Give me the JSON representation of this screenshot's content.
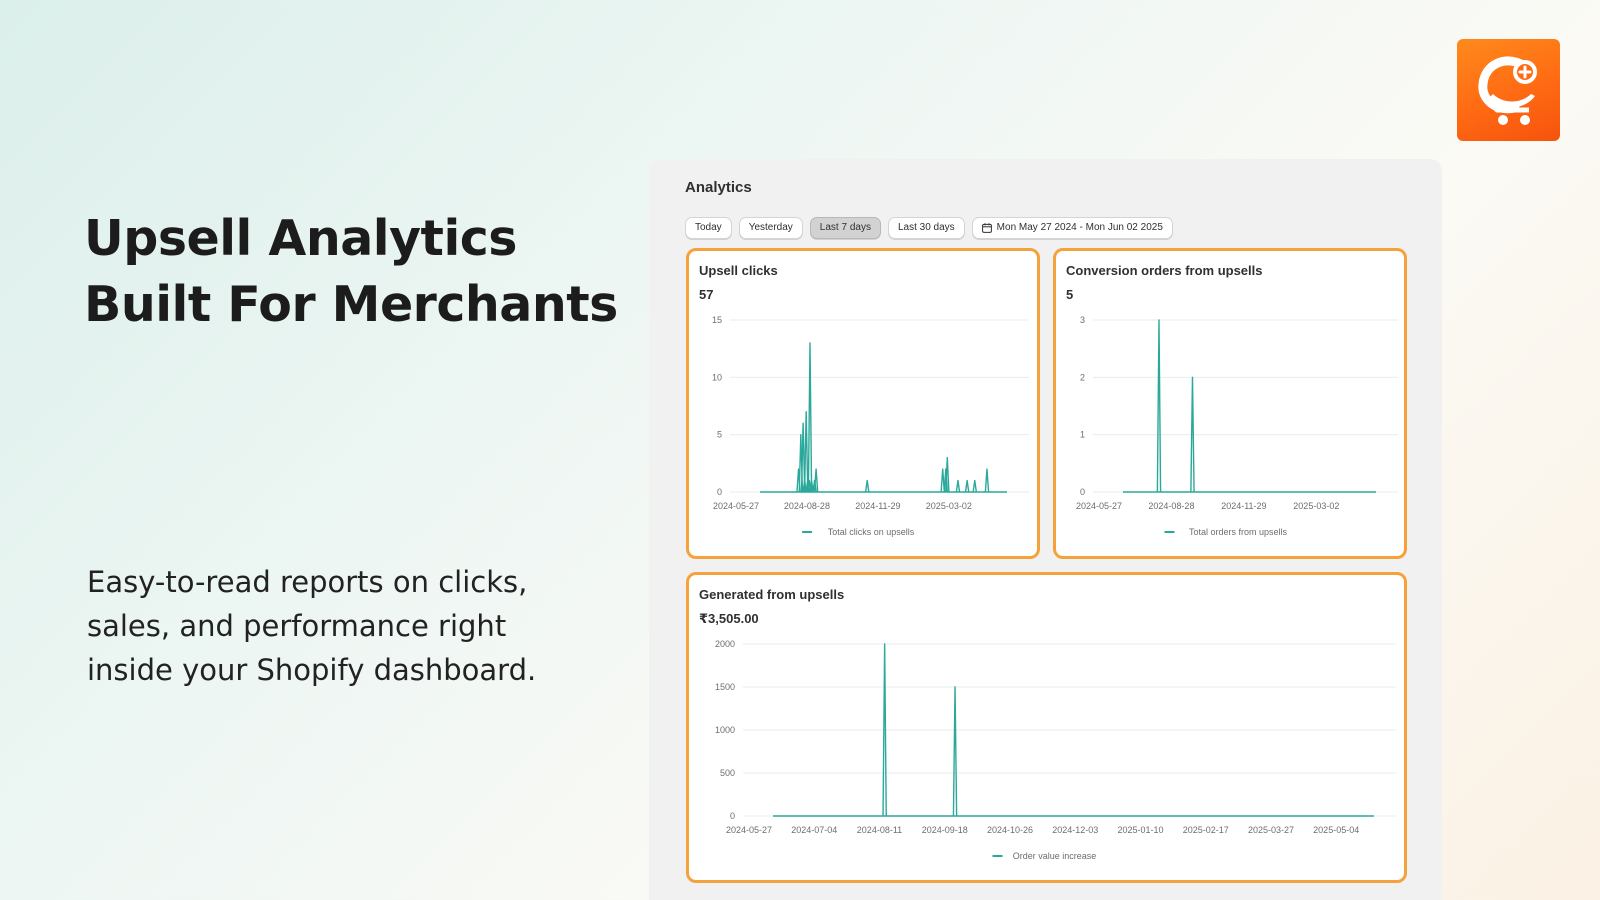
{
  "hero": {
    "title_line1": "Upsell Analytics",
    "title_line2": "Built For Merchants",
    "subtitle_line1": "Easy-to-read reports on clicks,",
    "subtitle_line2": "sales, and performance right",
    "subtitle_line3": "inside your Shopify dashboard."
  },
  "logo": {
    "icon": "cart-swirl-logo-icon",
    "color": "#ff6a13"
  },
  "analytics": {
    "title": "Analytics",
    "filters": [
      "Today",
      "Yesterday",
      "Last 7 days",
      "Last 30 days"
    ],
    "active_filter": "Last 7 days",
    "date_range": "Mon May 27 2024 - Mon Jun 02 2025",
    "date_icon": "calendar-icon"
  },
  "colors": {
    "accent_border": "#f5a23a",
    "series": "#2aa89a"
  },
  "chart_data": [
    {
      "type": "line",
      "title": "Upsell clicks",
      "total": "57",
      "legend": "Total clicks on upsells",
      "yticks": [
        "15",
        "10",
        "5",
        "0"
      ],
      "ylim": [
        0,
        15
      ],
      "xticks": [
        "2024-05-27",
        "2024-08-28",
        "2024-11-29",
        "2025-03-02"
      ],
      "x_start": "2024-05-27",
      "x_end": "2025-06-02",
      "points": [
        {
          "x": "2024-08-17",
          "y": 2
        },
        {
          "x": "2024-08-20",
          "y": 5
        },
        {
          "x": "2024-08-23",
          "y": 6
        },
        {
          "x": "2024-08-25",
          "y": 1
        },
        {
          "x": "2024-08-27",
          "y": 7
        },
        {
          "x": "2024-08-29",
          "y": 1
        },
        {
          "x": "2024-08-31",
          "y": 1
        },
        {
          "x": "2024-09-01",
          "y": 13
        },
        {
          "x": "2024-09-03",
          "y": 1
        },
        {
          "x": "2024-09-07",
          "y": 1
        },
        {
          "x": "2024-09-09",
          "y": 2
        },
        {
          "x": "2024-11-15",
          "y": 1
        },
        {
          "x": "2025-02-22",
          "y": 2
        },
        {
          "x": "2025-02-26",
          "y": 2
        },
        {
          "x": "2025-02-28",
          "y": 3
        },
        {
          "x": "2025-03-14",
          "y": 1
        },
        {
          "x": "2025-03-26",
          "y": 1
        },
        {
          "x": "2025-04-05",
          "y": 1
        },
        {
          "x": "2025-04-21",
          "y": 2
        }
      ]
    },
    {
      "type": "line",
      "title": "Conversion orders from upsells",
      "total": "5",
      "legend": "Total orders from upsells",
      "yticks": [
        "3",
        "2",
        "1",
        "0"
      ],
      "ylim": [
        0,
        3
      ],
      "xticks": [
        "2024-05-27",
        "2024-08-28",
        "2024-11-29",
        "2025-03-02"
      ],
      "x_start": "2024-05-27",
      "x_end": "2025-06-02",
      "points": [
        {
          "x": "2024-08-12",
          "y": 3
        },
        {
          "x": "2024-09-24",
          "y": 2
        }
      ]
    },
    {
      "type": "line",
      "title": "Generated from upsells",
      "total": "₹3,505.00",
      "legend": "Order value increase",
      "yticks": [
        "2000",
        "1500",
        "1000",
        "500",
        "0"
      ],
      "ylim": [
        0,
        2000
      ],
      "xticks": [
        "2024-05-27",
        "2024-07-04",
        "2024-08-11",
        "2024-09-18",
        "2024-10-26",
        "2024-12-03",
        "2025-01-10",
        "2025-02-17",
        "2025-03-27",
        "2025-05-04"
      ],
      "x_start": "2024-05-27",
      "x_end": "2025-06-02",
      "points": [
        {
          "x": "2024-08-14",
          "y": 2000
        },
        {
          "x": "2024-09-24",
          "y": 1500
        }
      ]
    }
  ]
}
